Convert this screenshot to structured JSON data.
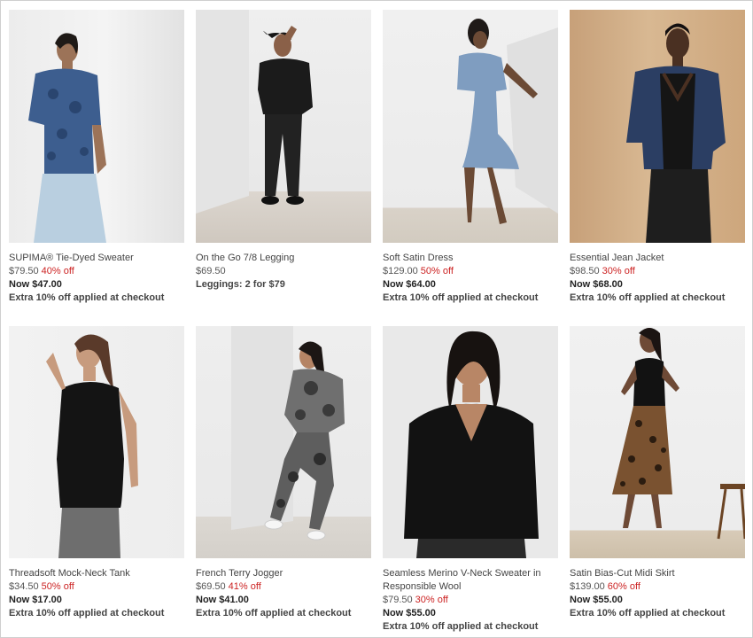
{
  "products": [
    {
      "name": "SUPIMA® Tie-Dyed Sweater",
      "original_price": "$79.50",
      "discount": "40% off",
      "now_price": "Now $47.00",
      "promo": "Extra 10% off applied at checkout"
    },
    {
      "name": "On the Go 7/8 Legging",
      "original_price": "$69.50",
      "discount": "",
      "now_price": "",
      "promo": "Leggings: 2 for $79"
    },
    {
      "name": "Soft Satin Dress",
      "original_price": "$129.00",
      "discount": "50% off",
      "now_price": "Now $64.00",
      "promo": "Extra 10% off applied at checkout"
    },
    {
      "name": "Essential Jean Jacket",
      "original_price": "$98.50",
      "discount": "30% off",
      "now_price": "Now $68.00",
      "promo": "Extra 10% off applied at checkout"
    },
    {
      "name": "Threadsoft Mock-Neck Tank",
      "original_price": "$34.50",
      "discount": "50% off",
      "now_price": "Now $17.00",
      "promo": "Extra 10% off applied at checkout"
    },
    {
      "name": "French Terry Jogger",
      "original_price": "$69.50",
      "discount": "41% off",
      "now_price": "Now $41.00",
      "promo": "Extra 10% off applied at checkout"
    },
    {
      "name": "Seamless Merino V-Neck Sweater in Responsible Wool",
      "original_price": "$79.50",
      "discount": "30% off",
      "now_price": "Now $55.00",
      "promo": "Extra 10% off applied at checkout"
    },
    {
      "name": "Satin Bias-Cut Midi Skirt",
      "original_price": "$139.00",
      "discount": "60% off",
      "now_price": "Now $55.00",
      "promo": "Extra 10% off applied at checkout"
    }
  ],
  "colors": {
    "discount": "#cc2222",
    "text": "#444444"
  }
}
